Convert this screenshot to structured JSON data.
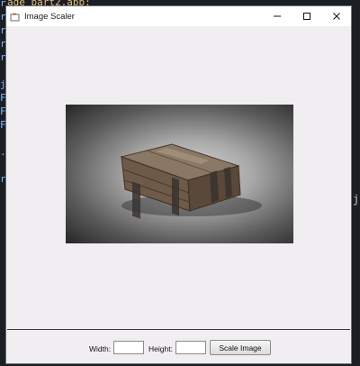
{
  "background": {
    "top_code": "age part2.app:",
    "left_code": "r\nr\nr\nr\nr\n\nj\nF\nF\nF\n\n.\n\nr",
    "right_code": "j"
  },
  "window": {
    "title": "Image Scaler",
    "app_icon": "java-app-icon",
    "minimize_glyph": "—",
    "maximize_glyph": "☐",
    "close_glyph": "✕"
  },
  "image": {
    "subject": "wooden-crate-photo"
  },
  "controls": {
    "width_label": "Width:",
    "width_value": "",
    "height_label": "Height:",
    "height_value": "",
    "scale_button": "Scale Image"
  },
  "colors": {
    "window_bg": "#f0eef1",
    "titlebar_bg": "#ffffff"
  }
}
